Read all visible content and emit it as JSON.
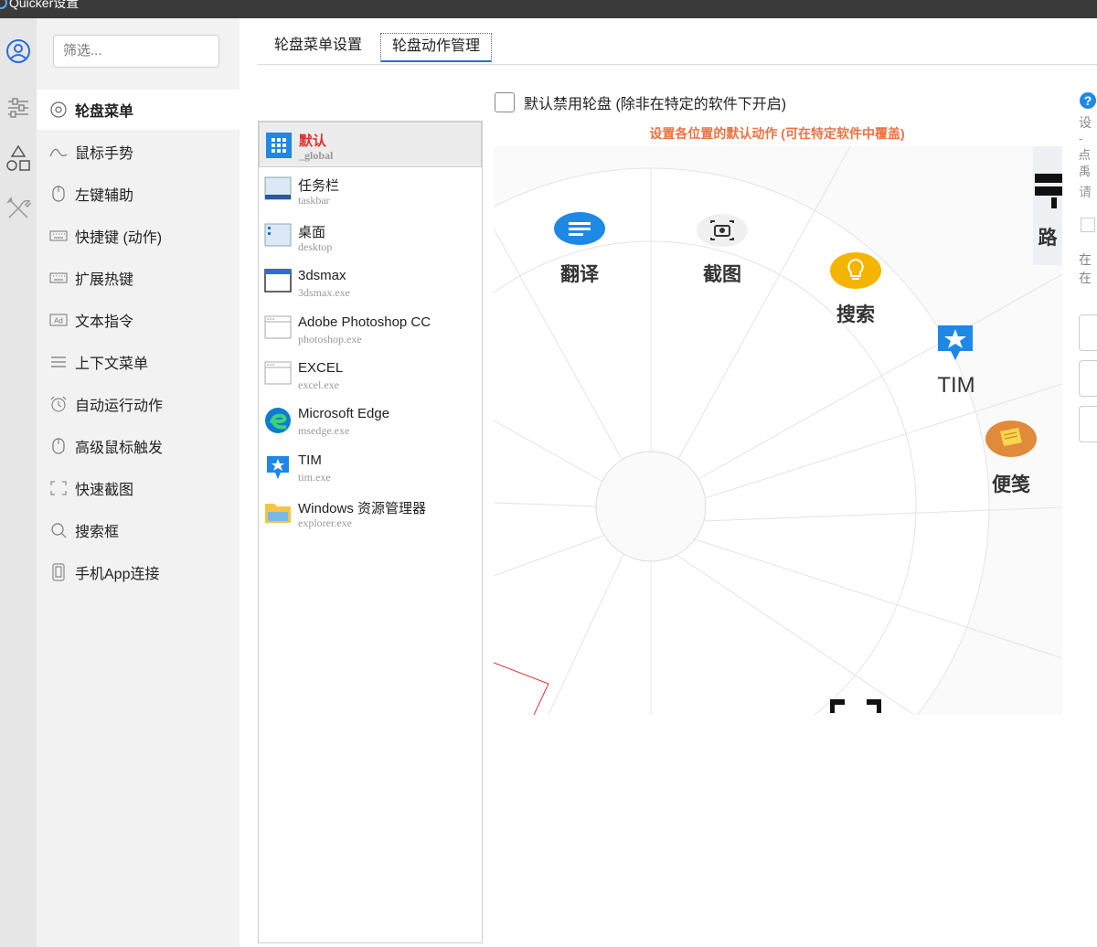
{
  "window": {
    "title": "Quicker设置"
  },
  "filter": {
    "placeholder": "筛选..."
  },
  "nav": {
    "items": [
      {
        "label": "轮盘菜单",
        "icon": "circle-dot-icon"
      },
      {
        "label": "鼠标手势",
        "icon": "gesture-wave-icon"
      },
      {
        "label": "左键辅助",
        "icon": "mouse-icon"
      },
      {
        "label": "快捷键 (动作)",
        "icon": "keyboard-icon"
      },
      {
        "label": "扩展热键",
        "icon": "keyboard-icon"
      },
      {
        "label": "文本指令",
        "icon": "ad-text-icon"
      },
      {
        "label": "上下文菜单",
        "icon": "menu-lines-icon"
      },
      {
        "label": "自动运行动作",
        "icon": "alarm-clock-icon"
      },
      {
        "label": "高级鼠标触发",
        "icon": "mouse-icon"
      },
      {
        "label": "快速截图",
        "icon": "screenshot-frame-icon"
      },
      {
        "label": "搜索框",
        "icon": "search-icon"
      },
      {
        "label": "手机App连接",
        "icon": "phone-icon"
      }
    ]
  },
  "tabs": [
    {
      "label": "轮盘菜单设置"
    },
    {
      "label": "轮盘动作管理"
    }
  ],
  "disable_wheel": {
    "label": "默认禁用轮盘 (除非在特定的软件下开启)"
  },
  "hint": "设置各位置的默认动作 (可在特定软件中覆盖)",
  "apps": [
    {
      "name": "默认",
      "sub": "_global",
      "icon": "grid-icon"
    },
    {
      "name": "任务栏",
      "sub": "taskbar",
      "icon": "taskbar-icon"
    },
    {
      "name": "桌面",
      "sub": "desktop",
      "icon": "desktop-icon"
    },
    {
      "name": "3dsmax",
      "sub": "3dsmax.exe",
      "icon": "window-icon"
    },
    {
      "name": "Adobe Photoshop CC",
      "sub": "photoshop.exe",
      "icon": "app-window-icon"
    },
    {
      "name": "EXCEL",
      "sub": "excel.exe",
      "icon": "app-window-icon"
    },
    {
      "name": "Microsoft Edge",
      "sub": "msedge.exe",
      "icon": "edge-icon"
    },
    {
      "name": "TIM",
      "sub": "tim.exe",
      "icon": "tim-icon"
    },
    {
      "name": "Windows 资源管理器",
      "sub": "explorer.exe",
      "icon": "folder-icon"
    }
  ],
  "wheel": {
    "actions": [
      {
        "label": "翻译",
        "icon": "translate-icon"
      },
      {
        "label": "截图",
        "icon": "camera-icon"
      },
      {
        "label": "搜索",
        "icon": "lightbulb-icon"
      },
      {
        "label": "TIM",
        "icon": "tim-icon"
      },
      {
        "label": "便笺",
        "icon": "sticky-note-icon"
      },
      {
        "label": "路",
        "icon": "router-icon"
      }
    ]
  },
  "right_panel": {
    "help_icon": "help-icon",
    "lines": [
      "设",
      "- 点",
      "- 禹",
      "请",
      "在",
      "在"
    ]
  },
  "colors": {
    "accent": "#2a6fd6",
    "hint": "#f07040",
    "selected_app": "#e03030"
  }
}
